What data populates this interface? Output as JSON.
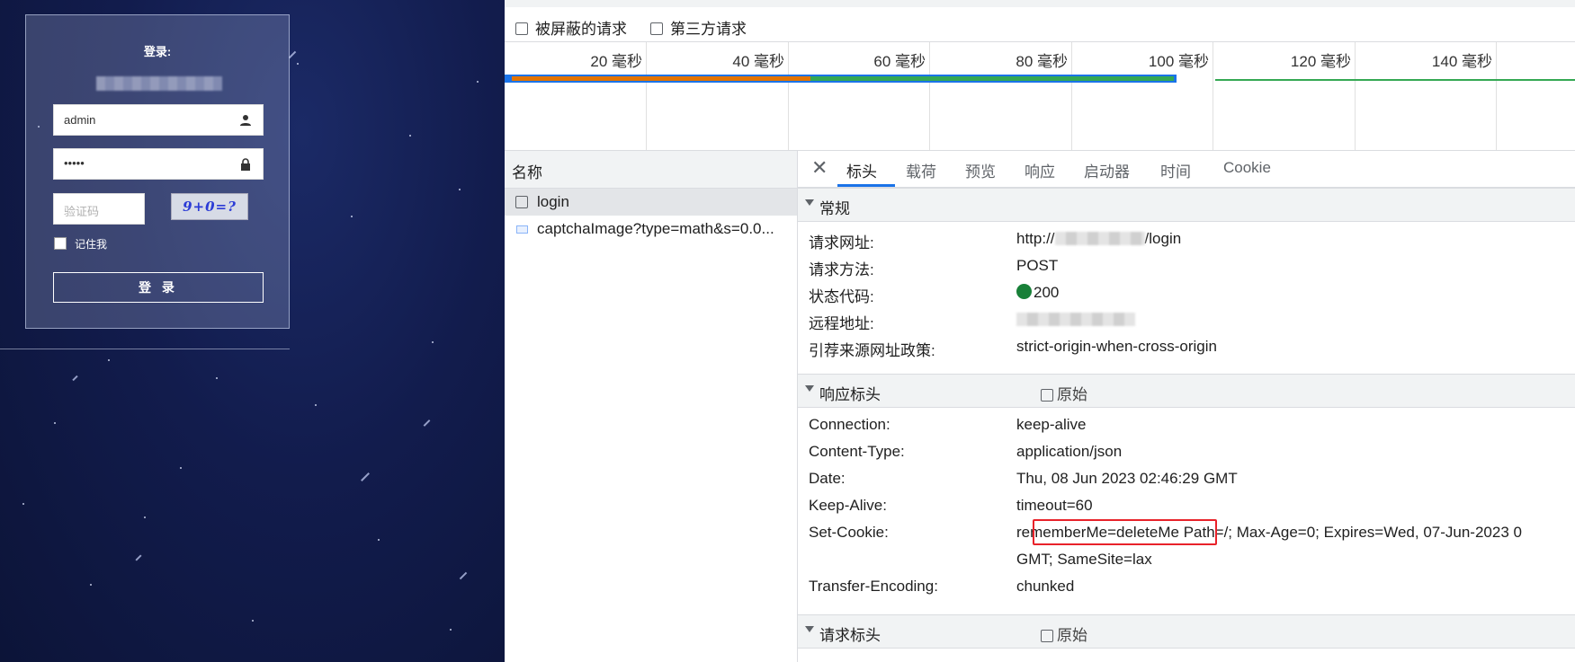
{
  "login_page": {
    "title": "登录:",
    "username_value": "admin",
    "password_value": "•••••",
    "captcha_placeholder": "验证码",
    "captcha_image_text": "9+0=?",
    "remember_label": "记住我",
    "login_button": "登 录"
  },
  "devtools": {
    "filters": {
      "blocked_requests": "被屏蔽的请求",
      "third_party_requests": "第三方请求"
    },
    "timeline_ticks": [
      "20 毫秒",
      "40 毫秒",
      "60 毫秒",
      "80 毫秒",
      "100 毫秒",
      "120 毫秒",
      "140 毫秒"
    ],
    "name_column": {
      "header": "名称",
      "requests": [
        "login",
        "captchaImage?type=math&s=0.0..."
      ]
    },
    "tabs": [
      "标头",
      "载荷",
      "预览",
      "响应",
      "启动器",
      "时间",
      "Cookie"
    ],
    "general": {
      "title": "常规",
      "request_url_label": "请求网址:",
      "request_url_prefix": "http://",
      "request_url_suffix": "/login",
      "method_label": "请求方法:",
      "method_value": "POST",
      "status_label": "状态代码:",
      "status_value": "200",
      "remote_label": "远程地址:",
      "referrer_label": "引荐来源网址政策:",
      "referrer_value": "strict-origin-when-cross-origin"
    },
    "response_headers": {
      "title": "响应标头",
      "raw_label": "原始",
      "rows": [
        {
          "key": "Connection:",
          "value": "keep-alive"
        },
        {
          "key": "Content-Type:",
          "value": "application/json"
        },
        {
          "key": "Date:",
          "value": "Thu, 08 Jun 2023 02:46:29 GMT"
        },
        {
          "key": "Keep-Alive:",
          "value": "timeout=60"
        }
      ],
      "set_cookie_key": "Set-Cookie:",
      "set_cookie_highlight": "rememberMe=deleteMe",
      "set_cookie_rest": "Path=/; Max-Age=0; Expires=Wed, 07-Jun-2023 0",
      "set_cookie_line2": "GMT; SameSite=lax",
      "transfer_key": "Transfer-Encoding:",
      "transfer_value": "chunked"
    },
    "request_headers": {
      "title": "请求标头",
      "raw_label": "原始"
    },
    "colors": {
      "status_green": "#188038",
      "highlight_red": "#e8222a",
      "waterfall_blue": "#1a73e8"
    }
  }
}
